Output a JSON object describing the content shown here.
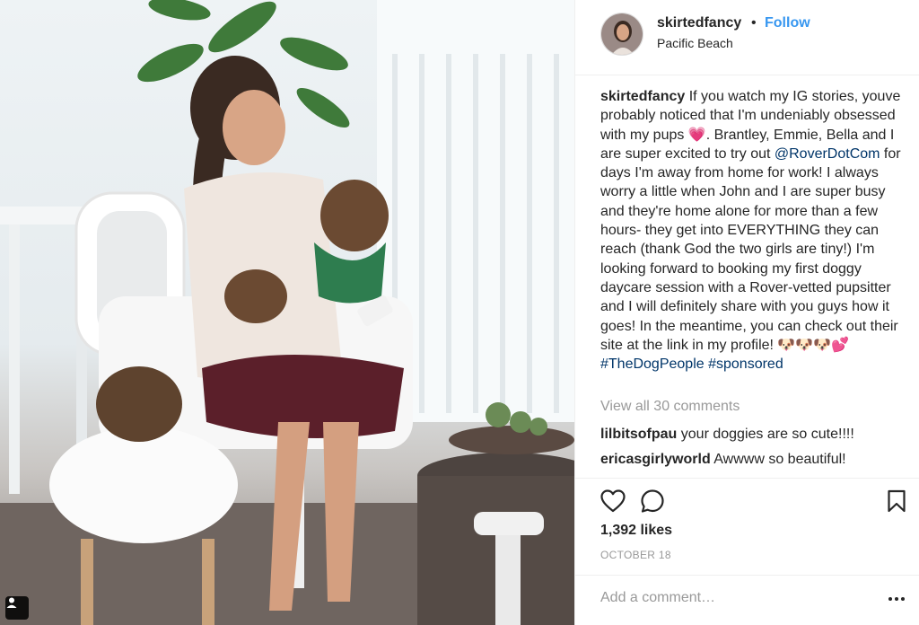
{
  "post": {
    "username": "skirtedfancy",
    "separator": "•",
    "follow_label": "Follow",
    "location": "Pacific Beach",
    "caption": {
      "username": "skirtedfancy",
      "text_1": " If you watch my IG stories, youve probably noticed that I'm undeniably obsessed with my pups 💗. Brantley, Emmie, Bella and I are super excited to try out ",
      "mention": "@RoverDotCom",
      "text_2": " for days I'm away from home for work! I always worry a little when John and I are super busy and they're home alone for more than a few hours- they get into EVERYTHING they can reach (thank God the two girls are tiny!) I'm looking forward to booking my first doggy daycare session with a Rover-vetted pupsitter and I will definitely share with you guys how it goes! In the meantime, you can check out their site at the link in my profile! ",
      "emoji": "🐶🐶🐶💕",
      "hashtag_1": "#TheDogPeople",
      "hashtag_2": "#sponsored"
    },
    "view_all_comments": "View all 30 comments",
    "comments": [
      {
        "username": "lilbitsofpau",
        "text": " your doggies are so cute!!!!"
      },
      {
        "username": "ericasgirlyworld",
        "text": " Awwww so beautiful!"
      }
    ],
    "likes": "1,392 likes",
    "date": "OCTOBER 18",
    "add_comment_placeholder": "Add a comment…",
    "icons": {
      "like": "heart-icon",
      "comment": "comment-bubble-icon",
      "save": "bookmark-icon",
      "more": "more-options-icon",
      "tagged": "tagged-person-icon"
    }
  },
  "colors": {
    "link_blue": "#3897f0",
    "mention_blue": "#003569",
    "muted_gray": "#999999",
    "text": "#262626",
    "divider": "#efefef"
  }
}
